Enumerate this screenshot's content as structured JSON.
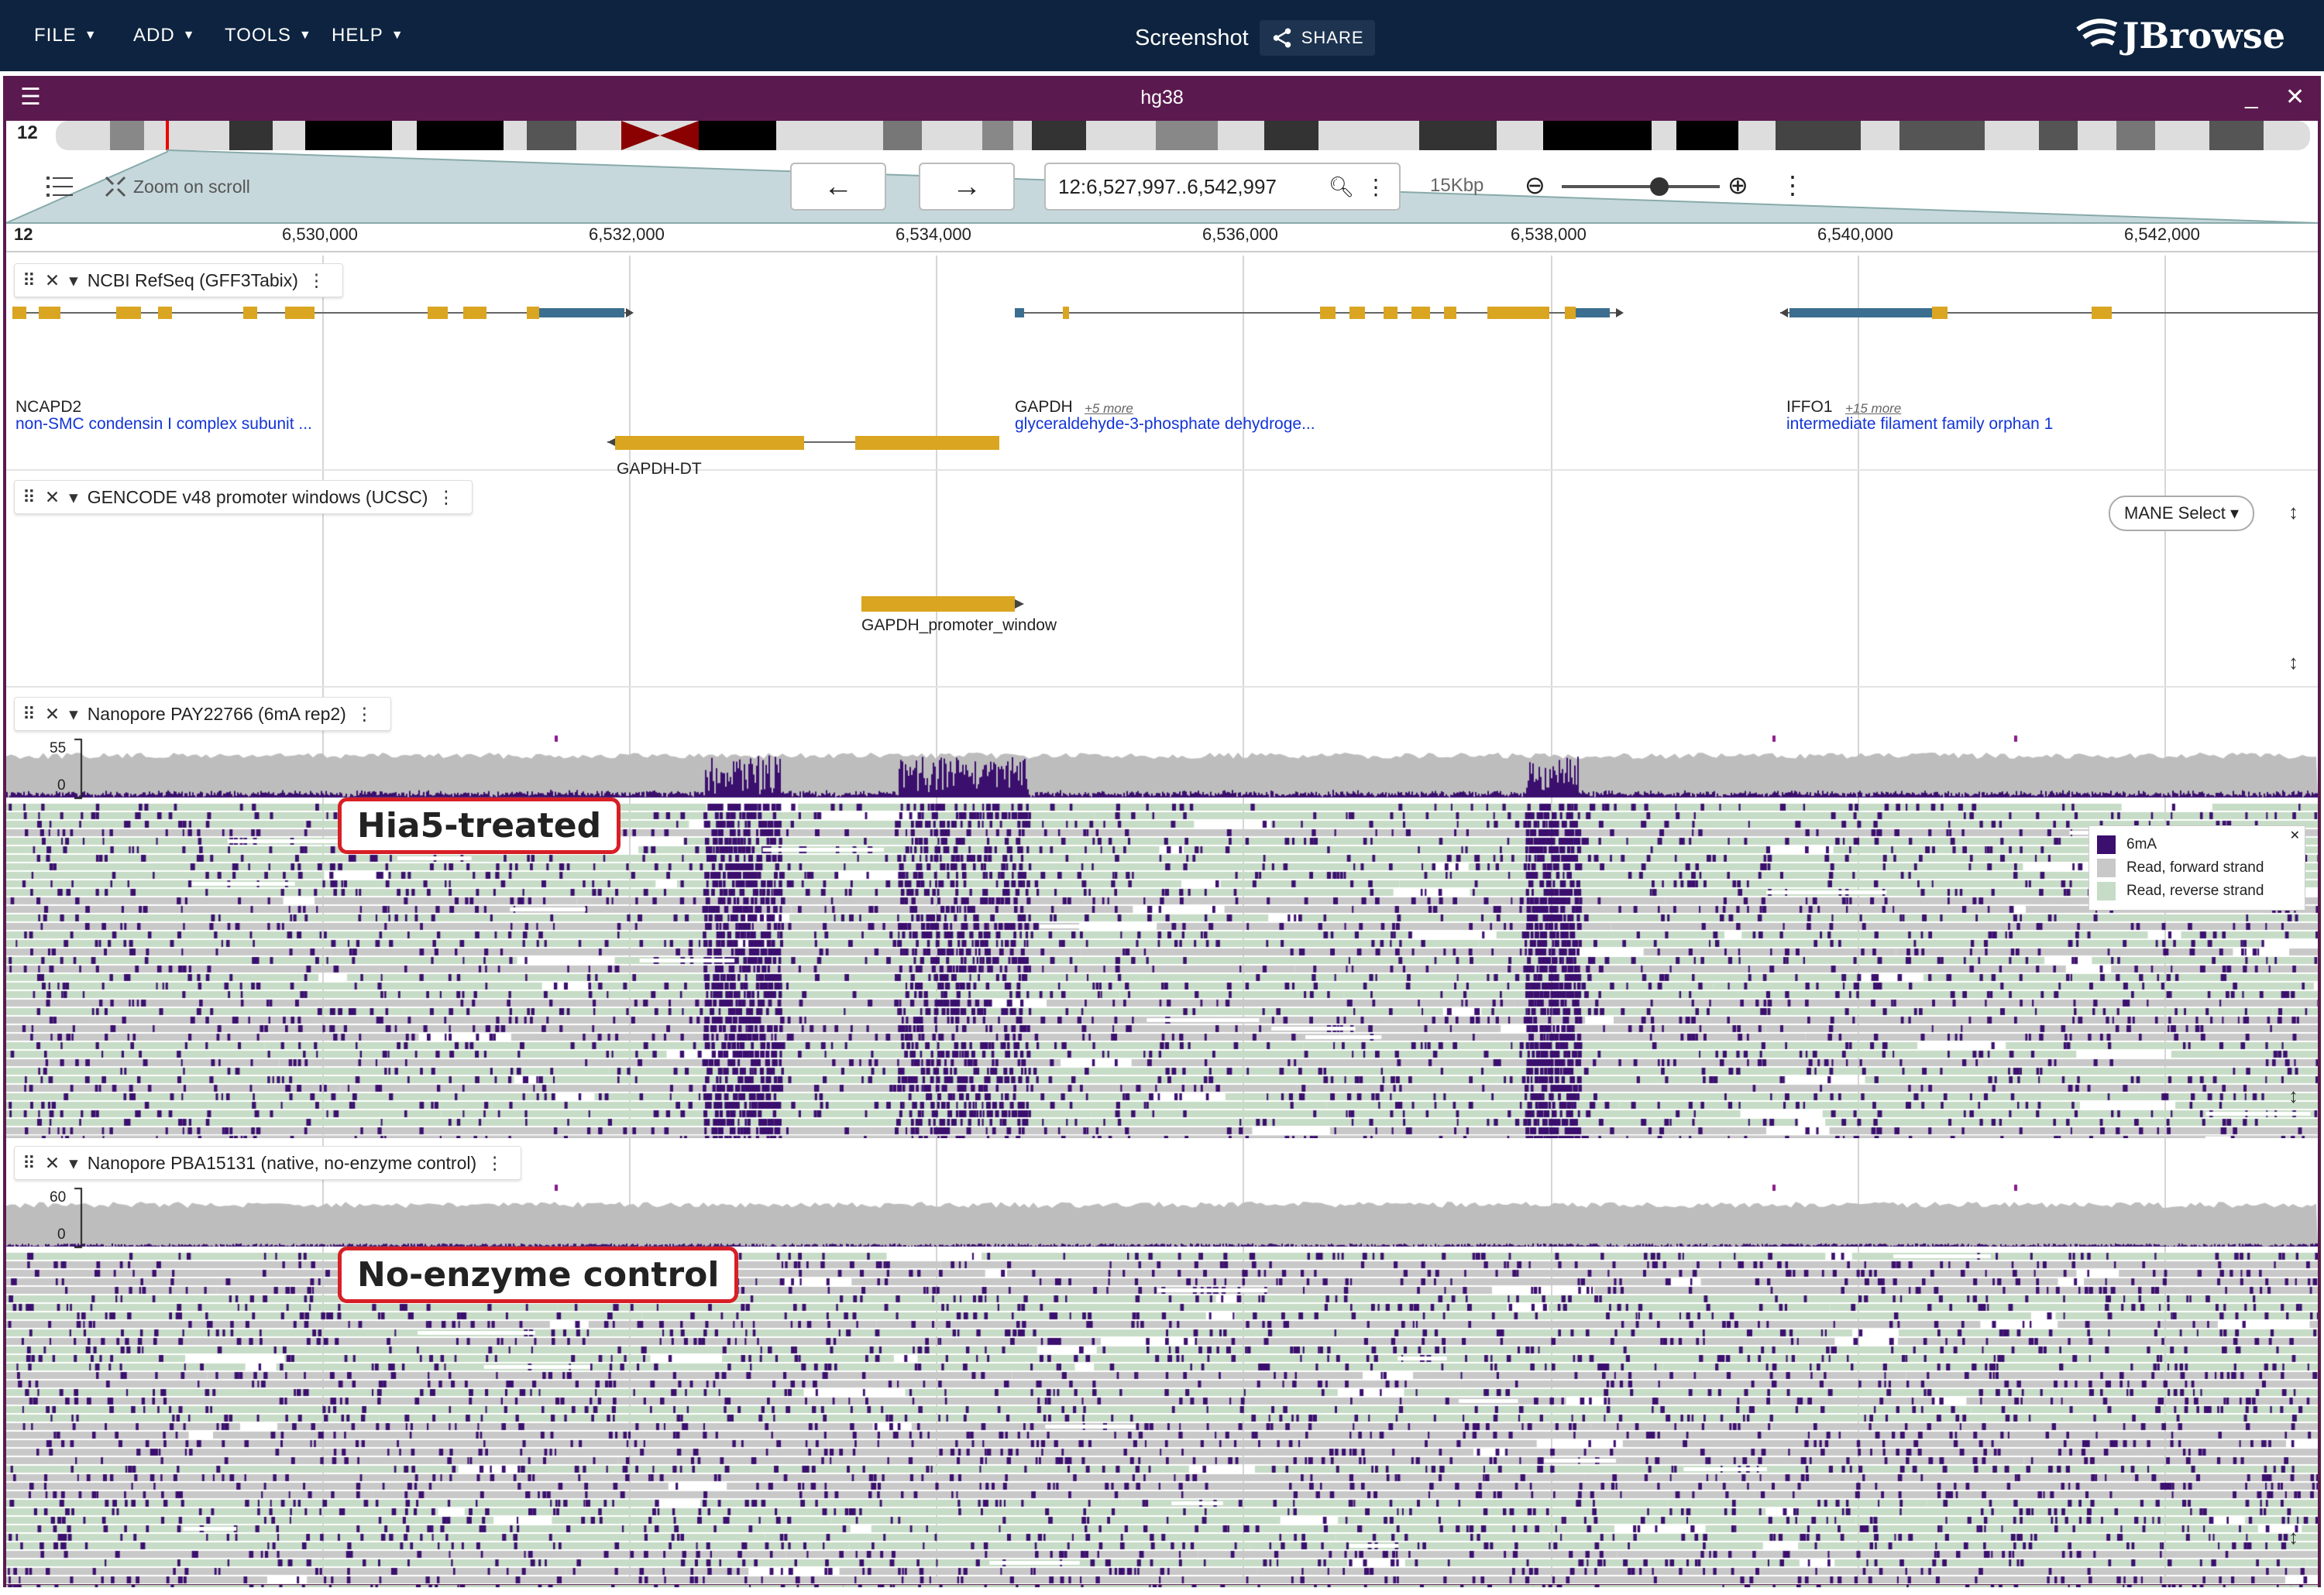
{
  "topbar": {
    "menus": [
      "FILE",
      "ADD",
      "TOOLS",
      "HELP"
    ],
    "center_title": "Screenshot",
    "share_label": "SHARE",
    "logo_text": "JBrowse"
  },
  "view": {
    "title": "hg38",
    "chromosome": "12",
    "zoom_on_scroll_label": "Zoom on scroll",
    "location": "12:6,527,997..6,542,997",
    "span_label": "15Kbp",
    "ruler_chr": "12",
    "ruler_ticks": [
      "6,530,000",
      "6,532,000",
      "6,534,000",
      "6,536,000",
      "6,538,000",
      "6,540,000",
      "6,542,000"
    ]
  },
  "tracks": {
    "refseq": {
      "title": "NCBI RefSeq (GFF3Tabix)",
      "mane_label": "MANE Select",
      "genes": [
        {
          "name": "NCAPD2",
          "desc": "non-SMC condensin I complex subunit ..."
        },
        {
          "name": "GAPDH",
          "more": "+5 more",
          "desc": "glyceraldehyde-3-phosphate dehydroge..."
        },
        {
          "name": "IFFO1",
          "more": "+15 more",
          "desc": "intermediate filament family orphan 1"
        },
        {
          "name": "GAPDH-DT"
        }
      ]
    },
    "gencode": {
      "title": "GENCODE v48 promoter windows (UCSC)",
      "feature": "GAPDH_promoter_window"
    },
    "nanopore1": {
      "title": "Nanopore PAY22766 (6mA rep2)",
      "ymax": "55",
      "ymin": "0",
      "callout": "Hia5-treated",
      "legend": [
        "6mA",
        "Read, forward strand",
        "Read, reverse strand"
      ]
    },
    "nanopore2": {
      "title": "Nanopore PBA15131 (native, no-enzyme control)",
      "ymax": "60",
      "ymin": "0",
      "callout": "No-enzyme control"
    }
  },
  "colors": {
    "topbar": "#0d233f",
    "view_header": "#5b1a4f",
    "gene_feature": "#daa520",
    "utr": "#3b6e8f",
    "mod_6mA": "#3b0f6e",
    "read_forward": "#c8c8c8",
    "read_reverse": "#c6dcc6"
  }
}
